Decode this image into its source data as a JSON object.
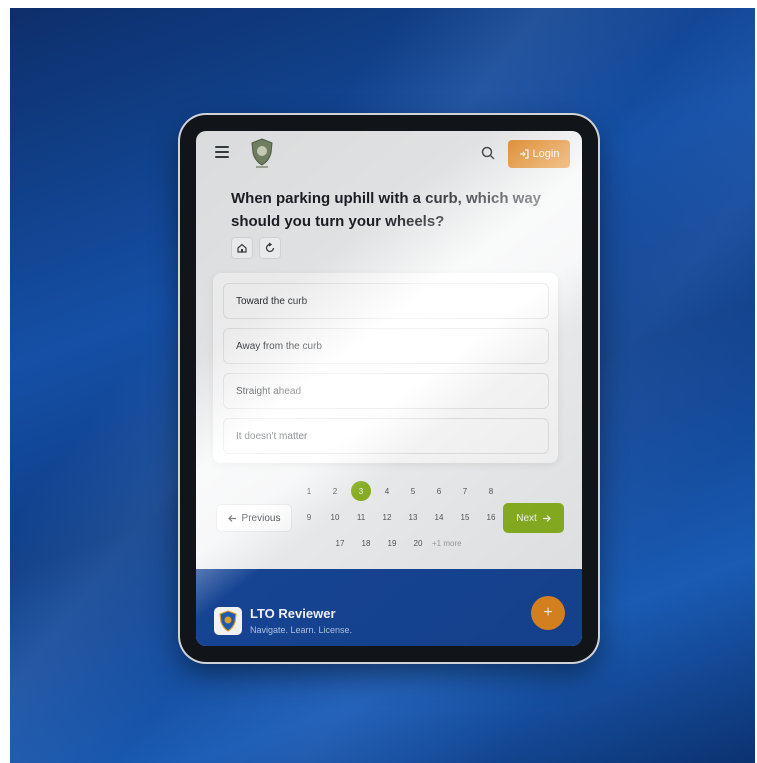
{
  "header": {
    "login_label": "Login"
  },
  "quiz": {
    "question": "When parking uphill with a curb, which way should you turn your wheels?",
    "options": [
      "Toward the curb",
      "Away from the curb",
      "Straight ahead",
      "It doesn't matter"
    ]
  },
  "pagination": {
    "previous_label": "Previous",
    "next_label": "Next",
    "pages": [
      "1",
      "2",
      "3",
      "4",
      "5",
      "6",
      "7",
      "8",
      "9",
      "10",
      "11",
      "12",
      "13",
      "14",
      "15",
      "16",
      "17",
      "18",
      "19",
      "20"
    ],
    "current_page": "3",
    "more_label": "+1 more"
  },
  "footer": {
    "app_name": "LTO Reviewer",
    "tagline": "Navigate. Learn. License."
  },
  "colors": {
    "accent_orange": "#e98c22",
    "accent_green": "#8db623",
    "footer_blue": "#17479a"
  },
  "icons": [
    "menu-icon",
    "shield-logo-icon",
    "search-icon",
    "login-icon",
    "home-icon",
    "restart-icon",
    "arrow-left-icon",
    "arrow-right-icon"
  ]
}
